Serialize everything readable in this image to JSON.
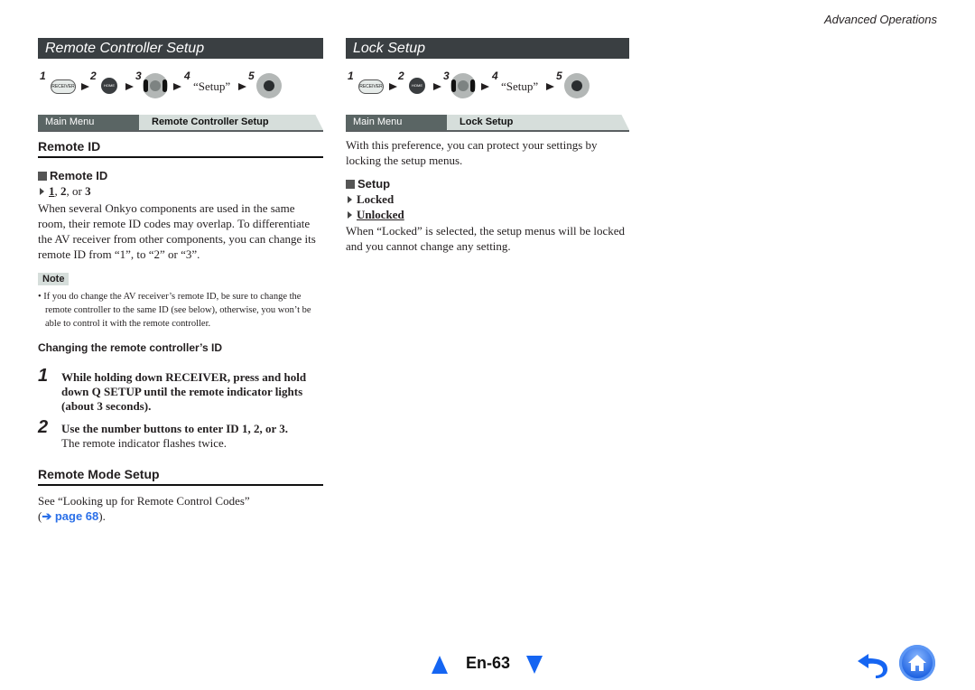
{
  "header": {
    "section": "Advanced Operations"
  },
  "left": {
    "banner": "Remote Controller Setup",
    "steps": {
      "n1": "1",
      "n2": "2",
      "n3": "3",
      "n4": "4",
      "n5": "5",
      "receiver_label": "RECEIVER",
      "home_label": "HOME",
      "setup": "“Setup”"
    },
    "breadcrumb": {
      "main": "Main Menu",
      "sub": "Remote Controller Setup"
    },
    "remote_id": {
      "heading": "Remote ID",
      "setting_label": "Remote ID",
      "options_default": "1",
      "options_rest_a": ", ",
      "options_2": "2",
      "options_rest_b": ", or ",
      "options_3": "3",
      "description": "When several Onkyo components are used in the same room, their remote ID codes may overlap. To differentiate the AV receiver from other components, you can change its remote ID from “1”, to “2” or “3”.",
      "note_label": "Note",
      "note_text": "• If you do change the AV receiver’s remote ID, be sure to change the remote controller to the same ID (see below), otherwise, you won’t be able to control it with the remote controller."
    },
    "changing": {
      "heading": "Changing the remote controller’s ID",
      "steps": [
        {
          "n": "1",
          "text": "While holding down RECEIVER, press and hold down Q SETUP until the remote indicator lights (about 3 seconds).",
          "sub": ""
        },
        {
          "n": "2",
          "text": "Use the number buttons to enter ID 1, 2, or 3.",
          "sub": "The remote indicator flashes twice."
        }
      ]
    },
    "remote_mode": {
      "heading": "Remote Mode Setup",
      "text": "See “Looking up for Remote Control Codes”",
      "link_open": "(",
      "link": "➔ page 68",
      "link_close": ")."
    }
  },
  "right": {
    "banner": "Lock Setup",
    "steps": {
      "n1": "1",
      "n2": "2",
      "n3": "3",
      "n4": "4",
      "n5": "5",
      "receiver_label": "RECEIVER",
      "home_label": "HOME",
      "setup": "“Setup”"
    },
    "breadcrumb": {
      "main": "Main Menu",
      "sub": "Lock Setup"
    },
    "intro": "With this preference, you can protect your settings by locking the setup menus.",
    "setting_label": "Setup",
    "options": [
      "Locked",
      "Unlocked"
    ],
    "default_option": "Unlocked",
    "description": "When “Locked” is selected, the setup menus will be locked and you cannot change any setting."
  },
  "footer": {
    "page": "En-63",
    "prev_icon": "triangle-up",
    "next_icon": "triangle-down",
    "back_icon": "return-arrow",
    "home_icon": "home",
    "accent": "#1565f2"
  }
}
